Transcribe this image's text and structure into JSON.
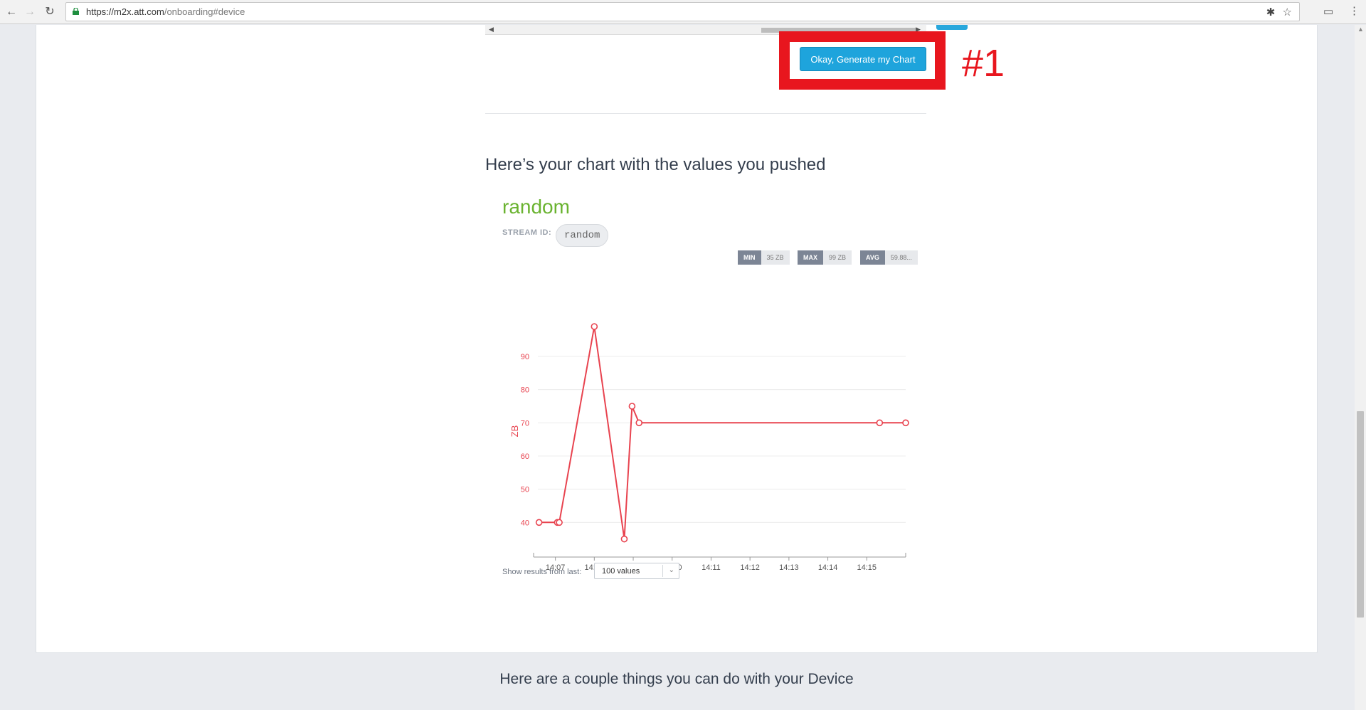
{
  "browser": {
    "url_host": "https://m2x.att.com",
    "url_path": "/onboarding#device"
  },
  "page": {
    "generate_button_label": "Okay, Generate my Chart",
    "step_annotation": "#1",
    "chart_heading": "Here’s your chart with the values you pushed",
    "stream_name": "random",
    "stream_id_label": "STREAM ID:",
    "stream_id_value": "random",
    "stats": {
      "min_label": "MIN",
      "min_value": "35 ZB",
      "max_label": "MAX",
      "max_value": "99 ZB",
      "avg_label": "AVG",
      "avg_value": "59.88..."
    },
    "results_label": "Show results from last:",
    "results_select_value": "100 values",
    "device_heading": "Here are a couple things you can do with your Device"
  },
  "colors": {
    "accent": "#1ea4dc",
    "annotation_red": "#e8161e",
    "stream_green": "#6ab330",
    "chart_line": "#e8434f"
  },
  "chart_data": {
    "type": "line",
    "ylabel": "ZB",
    "xlabel": "",
    "title": "",
    "ylim": [
      33,
      102
    ],
    "yticks": [
      40,
      50,
      60,
      70,
      80,
      90
    ],
    "xticks": [
      "14:07",
      "14:08",
      "14:09",
      "14:10",
      "14:11",
      "14:12",
      "14:13",
      "14:14",
      "14:15"
    ],
    "x_minutes_range": [
      6.55,
      16.0
    ],
    "series": [
      {
        "x": [
          "14:06:35",
          "14:07:03",
          "14:07:06",
          "14:08:00",
          "14:08:46",
          "14:08:58",
          "14:09:09",
          "14:15:20",
          "14:16:00"
        ],
        "x_minutes": [
          6.58,
          7.05,
          7.1,
          8.0,
          8.77,
          8.97,
          9.15,
          15.33,
          16.0
        ],
        "y": [
          40,
          40,
          40,
          99,
          35,
          75,
          70,
          70,
          70
        ]
      }
    ],
    "grid": "horizontal",
    "legend": "none"
  }
}
